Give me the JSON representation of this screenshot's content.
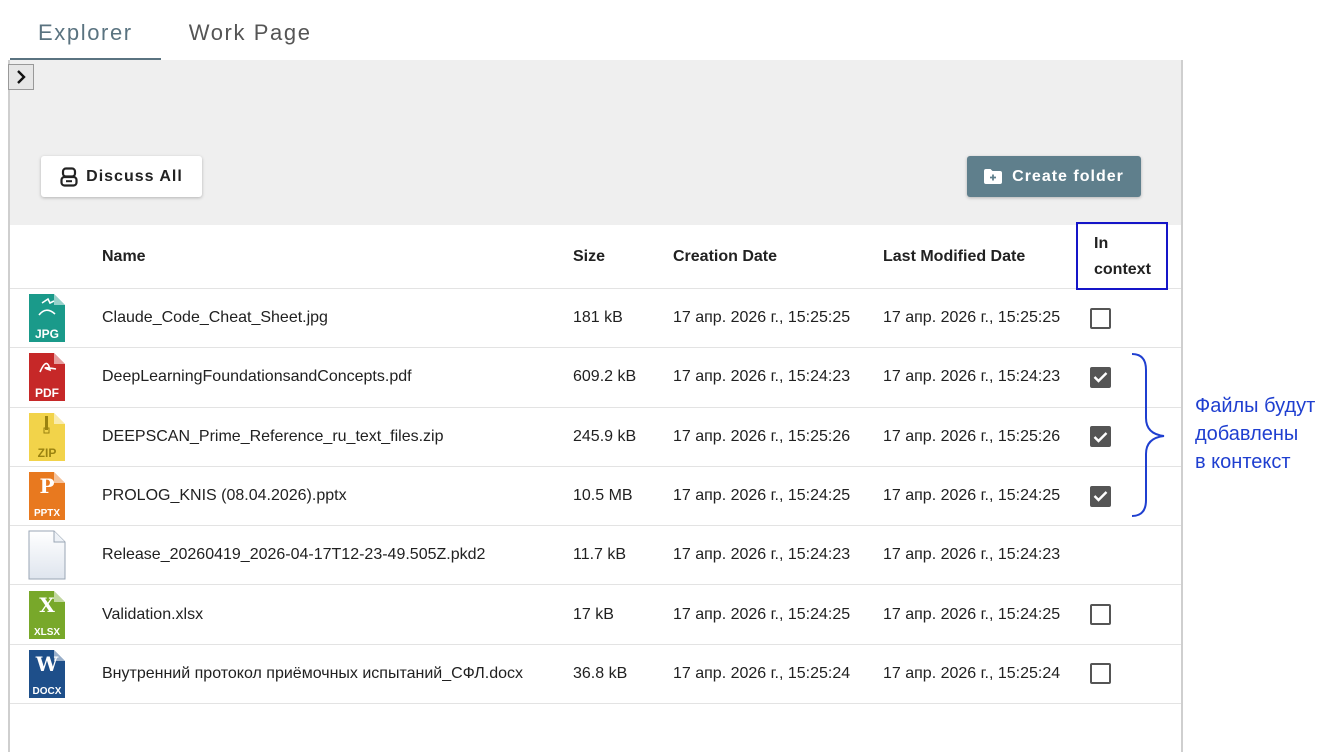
{
  "tabs": [
    {
      "label": "Explorer",
      "active": true
    },
    {
      "label": "Work Page",
      "active": false
    }
  ],
  "toolbar": {
    "discuss_label": "Discuss All",
    "create_label": "Create folder"
  },
  "table": {
    "headers": {
      "name": "Name",
      "size": "Size",
      "created": "Creation Date",
      "modified": "Last Modified Date",
      "in_context": "In context"
    },
    "rows": [
      {
        "icon": "jpg-file-icon",
        "type": "JPG",
        "name": "Claude_Code_Cheat_Sheet.jpg",
        "size": "181 kB",
        "created": "17 апр. 2026 г., 15:25:25",
        "modified": "17 апр. 2026 г., 15:25:25",
        "in_context": false
      },
      {
        "icon": "pdf-file-icon",
        "type": "PDF",
        "name": "DeepLearningFoundationsandConcepts.pdf",
        "size": "609.2 kB",
        "created": "17 апр. 2026 г., 15:24:23",
        "modified": "17 апр. 2026 г., 15:24:23",
        "in_context": true
      },
      {
        "icon": "zip-file-icon",
        "type": "ZIP",
        "name": "DEEPSCAN_Prime_Reference_ru_text_files.zip",
        "size": "245.9 kB",
        "created": "17 апр. 2026 г., 15:25:26",
        "modified": "17 апр. 2026 г., 15:25:26",
        "in_context": true
      },
      {
        "icon": "pptx-file-icon",
        "type": "PPTX",
        "name": "PROLOG_KNIS (08.04.2026).pptx",
        "size": "10.5 MB",
        "created": "17 апр. 2026 г., 15:24:25",
        "modified": "17 апр. 2026 г., 15:24:25",
        "in_context": true
      },
      {
        "icon": "generic-file-icon",
        "type": "",
        "name": "Release_20260419_2026-04-17T12-23-49.505Z.pkd2",
        "size": "11.7 kB",
        "created": "17 апр. 2026 г., 15:24:23",
        "modified": "17 апр. 2026 г., 15:24:23",
        "in_context": null
      },
      {
        "icon": "xlsx-file-icon",
        "type": "XLSX",
        "name": "Validation.xlsx",
        "size": "17 kB",
        "created": "17 апр. 2026 г., 15:24:25",
        "modified": "17 апр. 2026 г., 15:24:25",
        "in_context": false
      },
      {
        "icon": "docx-file-icon",
        "type": "DOCX",
        "name": "Внутренний протокол приёмочных испытаний_СФЛ.docx",
        "size": "36.8 kB",
        "created": "17 апр. 2026 г., 15:25:24",
        "modified": "17 апр. 2026 г., 15:25:24",
        "in_context": false
      }
    ]
  },
  "annotation": {
    "lines": [
      "Файлы будут",
      "добавлены",
      "в контекст"
    ],
    "color": "#1f3fd0"
  },
  "colors": {
    "accent": "#5a7380",
    "create_button": "#5f7f8c",
    "checkbox": "#555555",
    "highlight_frame": "#1515c8"
  }
}
